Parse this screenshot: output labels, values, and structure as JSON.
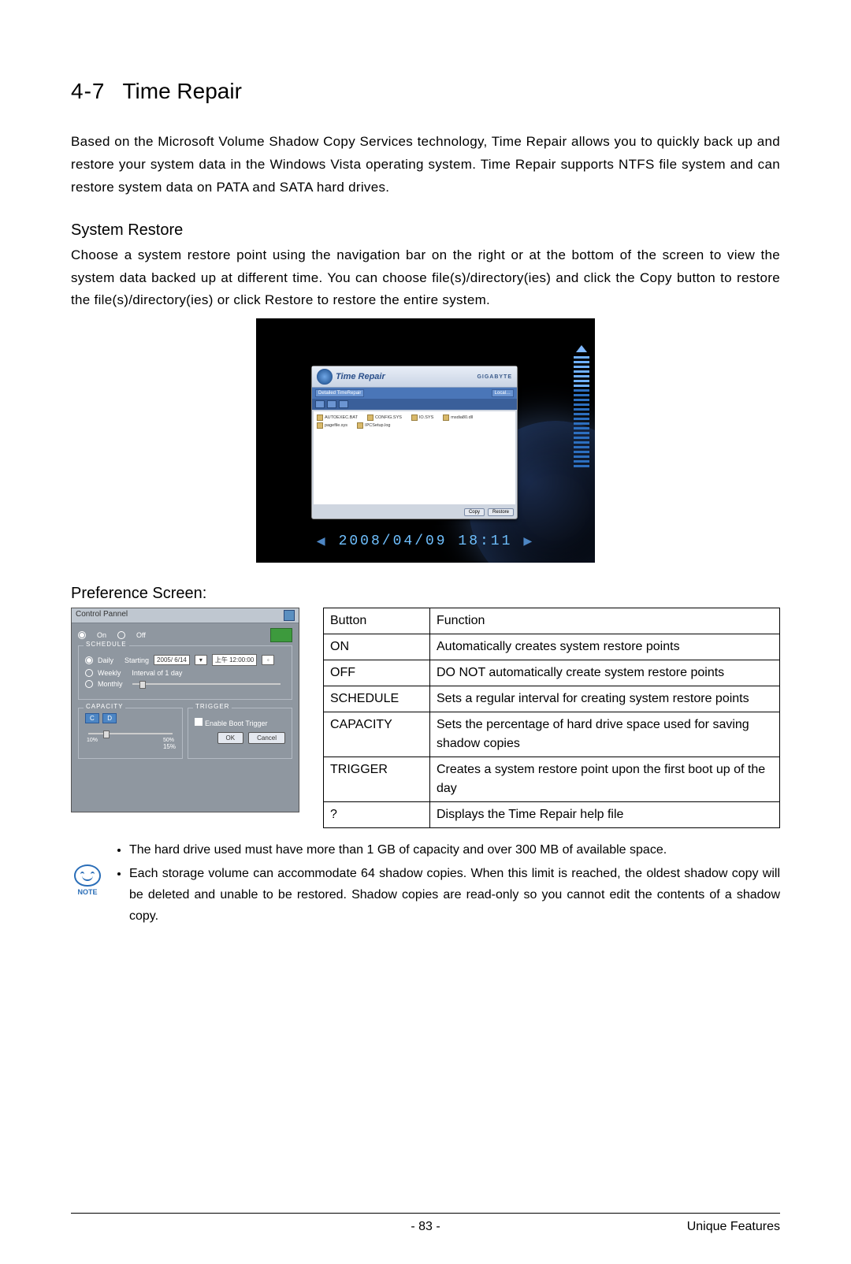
{
  "section": {
    "number": "4-7",
    "title": "Time Repair"
  },
  "intro": "Based on the Microsoft Volume Shadow Copy Services technology, Time Repair allows you to quickly back up and restore your system data in the Windows Vista operating system. Time Repair supports NTFS file system and can restore system data on PATA and SATA hard drives.",
  "sys_restore": {
    "heading": "System Restore",
    "text_a": "Choose a system restore point using the navigation bar on the right or at the bottom of the screen to view the system data backed up at different time. You can choose file(s)/directory(ies) and click the ",
    "copy": "Copy",
    "text_b": " button to restore the file(s)/directory(ies) or click ",
    "restore": "Restore",
    "text_c": " to restore the entire system."
  },
  "fig1": {
    "win_title": "Time Repair",
    "brand": "GIGABYTE",
    "toolbar": "Detailed TimeRepair",
    "drop": "Local…",
    "files": [
      "AUTOEXEC.BAT",
      "CONFIG.SYS",
      "msdia80.dll",
      "pagefile.sys",
      "IO.SYS",
      "IPCSetup.log"
    ],
    "copy_btn": "Copy",
    "restore_btn": "Restore",
    "timestamp": "2008/04/09   18:11"
  },
  "pref": {
    "heading": "Preference Screen:",
    "title": "Control Pannel",
    "on": "On",
    "off": "Off",
    "schedule": "SCHEDULE",
    "daily": "Daily",
    "weekly": "Weekly",
    "monthly": "Monthly",
    "starting": "Starting",
    "date": "2005/ 6/14",
    "time": "上午 12:00:00",
    "interval": "Interval of  1    day",
    "capacity": "CAPACITY",
    "drive_c": "C",
    "drive_d": "D",
    "cap_lo": "10%",
    "cap_hi": "50%",
    "cap_val": "15%",
    "trigger": "TRIGGER",
    "trigger_label": "Enable Boot Trigger",
    "ok": "OK",
    "cancel": "Cancel"
  },
  "table": {
    "head": [
      "Button",
      "Function"
    ],
    "rows": [
      [
        "ON",
        "Automatically creates system restore points"
      ],
      [
        "OFF",
        "DO NOT automatically create system restore points"
      ],
      [
        "SCHEDULE",
        "Sets a regular interval for creating system restore points"
      ],
      [
        "CAPACITY",
        "Sets the percentage of hard drive space used for saving shadow copies"
      ],
      [
        "TRIGGER",
        "Creates a system restore point upon the first boot up of the day"
      ],
      [
        "?",
        "Displays the Time Repair help file"
      ]
    ]
  },
  "notes": {
    "label": "NOTE",
    "items": [
      "The hard drive used must have more than 1 GB of capacity and over 300 MB of available space.",
      "Each storage volume can accommodate 64 shadow copies. When this limit is reached, the oldest shadow copy will be deleted and unable to be restored. Shadow copies are read-only so you cannot edit the contents of a shadow copy."
    ]
  },
  "footer": {
    "page": "- 83 -",
    "right": "Unique Features"
  }
}
